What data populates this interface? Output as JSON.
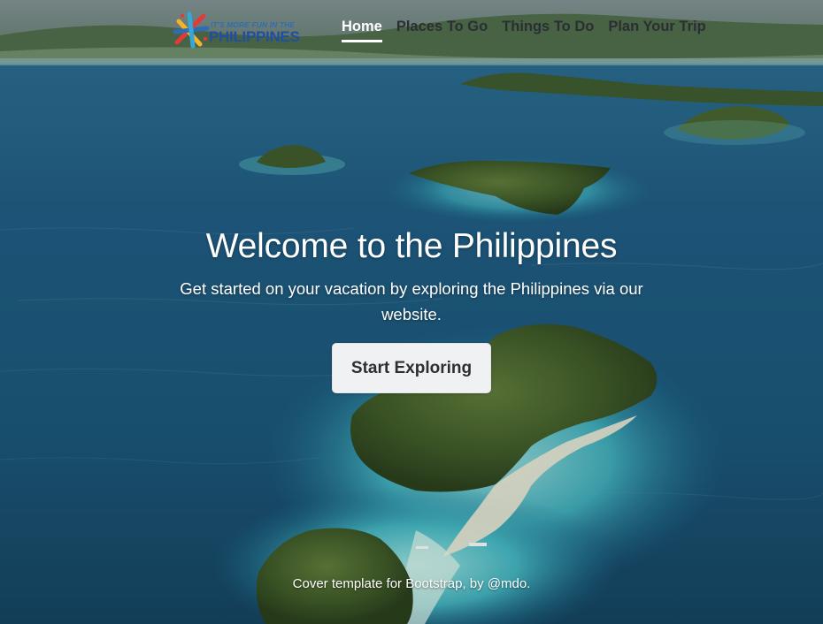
{
  "brand": {
    "tagline": "IT'S MORE FUN IN THE",
    "name": "PHILIPPINES",
    "colors": [
      "#e03b3b",
      "#f3b32a",
      "#2e6db6",
      "#38a6d9"
    ]
  },
  "nav": {
    "items": [
      {
        "label": "Home",
        "active": true
      },
      {
        "label": "Places To Go",
        "active": false
      },
      {
        "label": "Things To Do",
        "active": false
      },
      {
        "label": "Plan Your Trip",
        "active": false
      }
    ]
  },
  "hero": {
    "title": "Welcome to the Philippines",
    "lead": "Get started on your vacation by exploring the Philippines via our website.",
    "button_label": "Start Exploring"
  },
  "footer": {
    "text": "Cover template for Bootstrap, by @mdo."
  },
  "icons": {
    "logo": "philippines-sun-star-logo"
  }
}
